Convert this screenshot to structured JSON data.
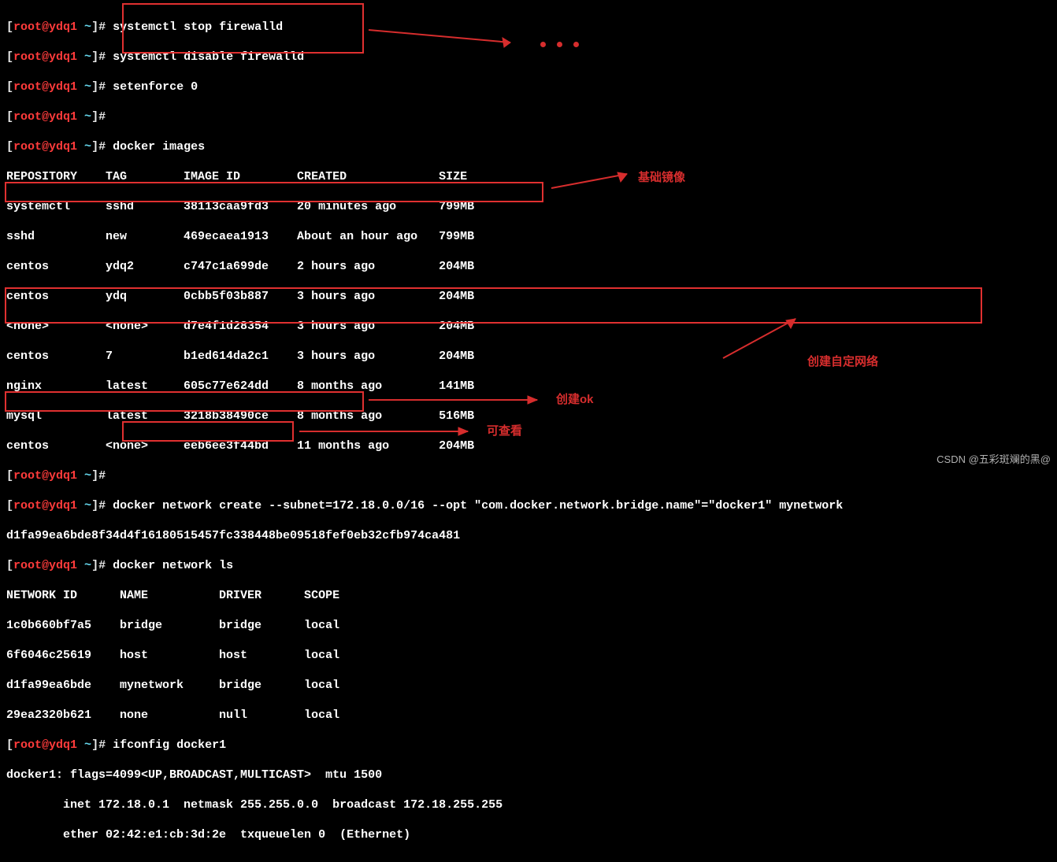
{
  "prompt": {
    "user": "root",
    "host": "ydq1",
    "cwd": "~",
    "marker": "#"
  },
  "cmds": {
    "c1": "systemctl stop firewalld",
    "c2": "systemctl disable firewalld",
    "c3": "setenforce 0",
    "c4": "docker images",
    "c5": "docker network create --subnet=172.18.0.0/16 --opt \"com.docker.network.bridge.name\"=\"docker1\" mynetwork",
    "c5_out": "d1fa99ea6bde8f34d4f16180515457fc338448be09518fef0eb32cfb974ca481",
    "c6": "docker network ls",
    "c7": "ifconfig docker1"
  },
  "docker_images": {
    "header": {
      "repo": "REPOSITORY",
      "tag": "TAG",
      "id": "IMAGE ID",
      "created": "CREATED",
      "size": "SIZE"
    },
    "rows": [
      {
        "repo": "systemctl",
        "tag": "sshd",
        "id": "38113caa9fd3",
        "created": "20 minutes ago",
        "size": "799MB"
      },
      {
        "repo": "sshd",
        "tag": "new",
        "id": "469ecaea1913",
        "created": "About an hour ago",
        "size": "799MB"
      },
      {
        "repo": "centos",
        "tag": "ydq2",
        "id": "c747c1a699de",
        "created": "2 hours ago",
        "size": "204MB"
      },
      {
        "repo": "centos",
        "tag": "ydq",
        "id": "0cbb5f03b887",
        "created": "3 hours ago",
        "size": "204MB"
      },
      {
        "repo": "<none>",
        "tag": "<none>",
        "id": "d7e4f1d28354",
        "created": "3 hours ago",
        "size": "204MB"
      },
      {
        "repo": "centos",
        "tag": "7",
        "id": "b1ed614da2c1",
        "created": "3 hours ago",
        "size": "204MB"
      },
      {
        "repo": "nginx",
        "tag": "latest",
        "id": "605c77e624dd",
        "created": "8 months ago",
        "size": "141MB"
      },
      {
        "repo": "mysql",
        "tag": "latest",
        "id": "3218b38490ce",
        "created": "8 months ago",
        "size": "516MB"
      },
      {
        "repo": "centos",
        "tag": "<none>",
        "id": "eeb6ee3f44bd",
        "created": "11 months ago",
        "size": "204MB"
      }
    ]
  },
  "docker_networks": {
    "header": {
      "id": "NETWORK ID",
      "name": "NAME",
      "driver": "DRIVER",
      "scope": "SCOPE"
    },
    "rows": [
      {
        "id": "1c0b660bf7a5",
        "name": "bridge",
        "driver": "bridge",
        "scope": "local"
      },
      {
        "id": "6f6046c25619",
        "name": "host",
        "driver": "host",
        "scope": "local"
      },
      {
        "id": "d1fa99ea6bde",
        "name": "mynetwork",
        "driver": "bridge",
        "scope": "local"
      },
      {
        "id": "29ea2320b621",
        "name": "none",
        "driver": "null",
        "scope": "local"
      }
    ]
  },
  "ifconfig": {
    "l1": "docker1: flags=4099<UP,BROADCAST,MULTICAST>  mtu 1500",
    "l2": "        inet 172.18.0.1  netmask 255.255.0.0  broadcast 172.18.255.255",
    "l3": "        ether 02:42:e1:cb:3d:2e  txqueuelen 0  (Ethernet)"
  },
  "annotations": {
    "a1": "基础镜像",
    "a2": "创建自定网络",
    "a3": "创建ok",
    "a4": "可查看"
  },
  "watermark": "CSDN @五彩斑斓的黑@"
}
